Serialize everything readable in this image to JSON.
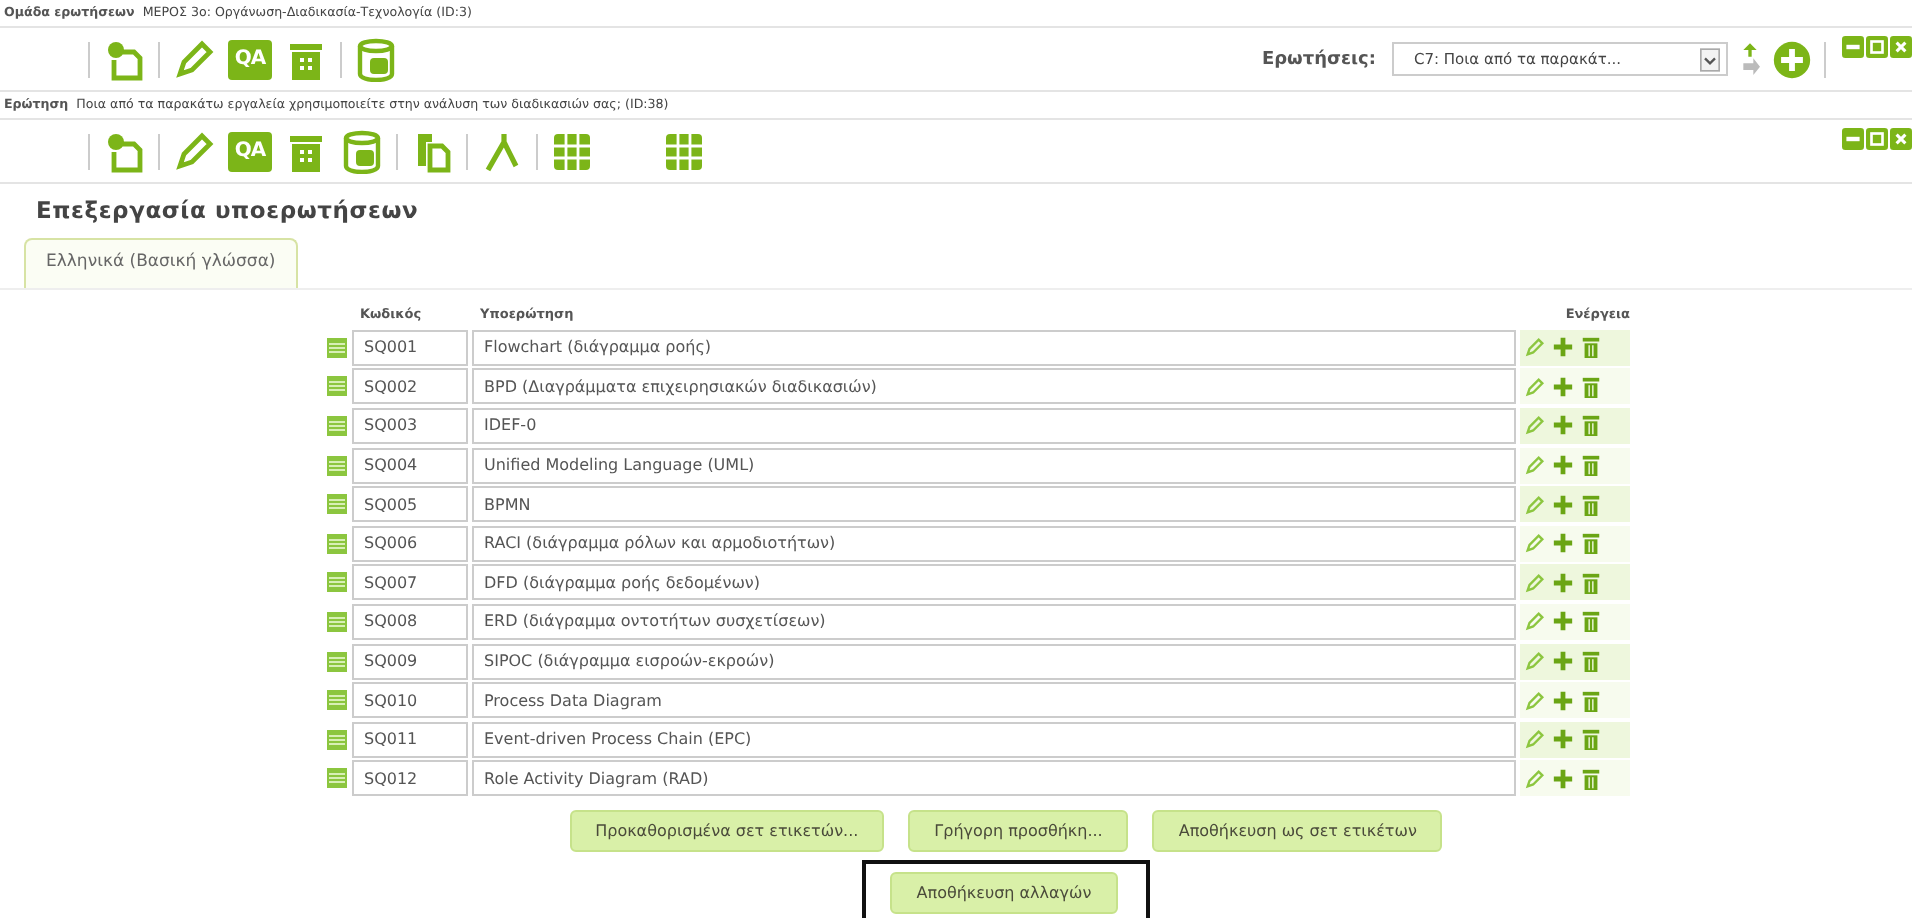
{
  "group": {
    "label": "Ομάδα ερωτήσεων",
    "value": "ΜΕΡΟΣ 3ο: Οργάνωση-Διαδικασία-Τεχνολογία (ID:3)"
  },
  "group_toolbar": [
    {
      "kind": "new"
    },
    {
      "kind": "edit"
    },
    {
      "kind": "qa",
      "label": "QA"
    },
    {
      "kind": "delete"
    },
    {
      "kind": "database"
    }
  ],
  "questions_picker": {
    "label": "Ερωτήσεις:",
    "value": "C7: Ποια από τα παρακάτ..."
  },
  "question": {
    "label": "Ερώτηση",
    "value": "Ποια από τα παρακάτω εργαλεία χρησιμοποιείτε στην ανάλυση των διαδικασιών σας; (ID:38)"
  },
  "question_toolbar": [
    {
      "kind": "new"
    },
    {
      "kind": "edit"
    },
    {
      "kind": "qa",
      "label": "QA"
    },
    {
      "kind": "delete"
    },
    {
      "kind": "database"
    },
    {
      "kind": "copy"
    },
    {
      "kind": "branch"
    },
    {
      "kind": "grid"
    },
    {
      "kind": "grid"
    }
  ],
  "heading": "Επεξεργασία υποερωτήσεων",
  "tabs": [
    {
      "label": "Ελληνικά (Βασική γλώσσα)",
      "selected": true
    }
  ],
  "table": {
    "columns": [
      "Κωδικός",
      "Υποερώτηση",
      "Ενέργεια"
    ],
    "rows": [
      {
        "code": "SQ001",
        "text": "Flowchart (διάγραμμα ροής)"
      },
      {
        "code": "SQ002",
        "text": "BPD (Διαγράμματα επιχειρησιακών διαδικασιών)"
      },
      {
        "code": "SQ003",
        "text": "IDEF-0"
      },
      {
        "code": "SQ004",
        "text": "Unified Modeling Language (UML)"
      },
      {
        "code": "SQ005",
        "text": "BPMN"
      },
      {
        "code": "SQ006",
        "text": "RACI (διάγραμμα ρόλων και αρμοδιοτήτων)"
      },
      {
        "code": "SQ007",
        "text": "DFD (διάγραμμα ροής δεδομένων)"
      },
      {
        "code": "SQ008",
        "text": "ERD (διάγραμμα οντοτήτων συσχετίσεων)"
      },
      {
        "code": "SQ009",
        "text": "SIPOC (διάγραμμα εισροών-εκροών)"
      },
      {
        "code": "SQ010",
        "text": "Process Data Diagram"
      },
      {
        "code": "SQ011",
        "text": "Event-driven Process Chain (EPC)"
      },
      {
        "code": "SQ012",
        "text": "Role Activity Diagram (RAD)"
      }
    ]
  },
  "buttons": [
    "Προκαθορισμένα σετ ετικετών...",
    "Γρήγορη προσθήκη...",
    "Αποθήκευση ως σετ ετικέτων"
  ],
  "save_button": {
    "label": "Αποθήκευση αλλαγών",
    "highlighted": true
  }
}
